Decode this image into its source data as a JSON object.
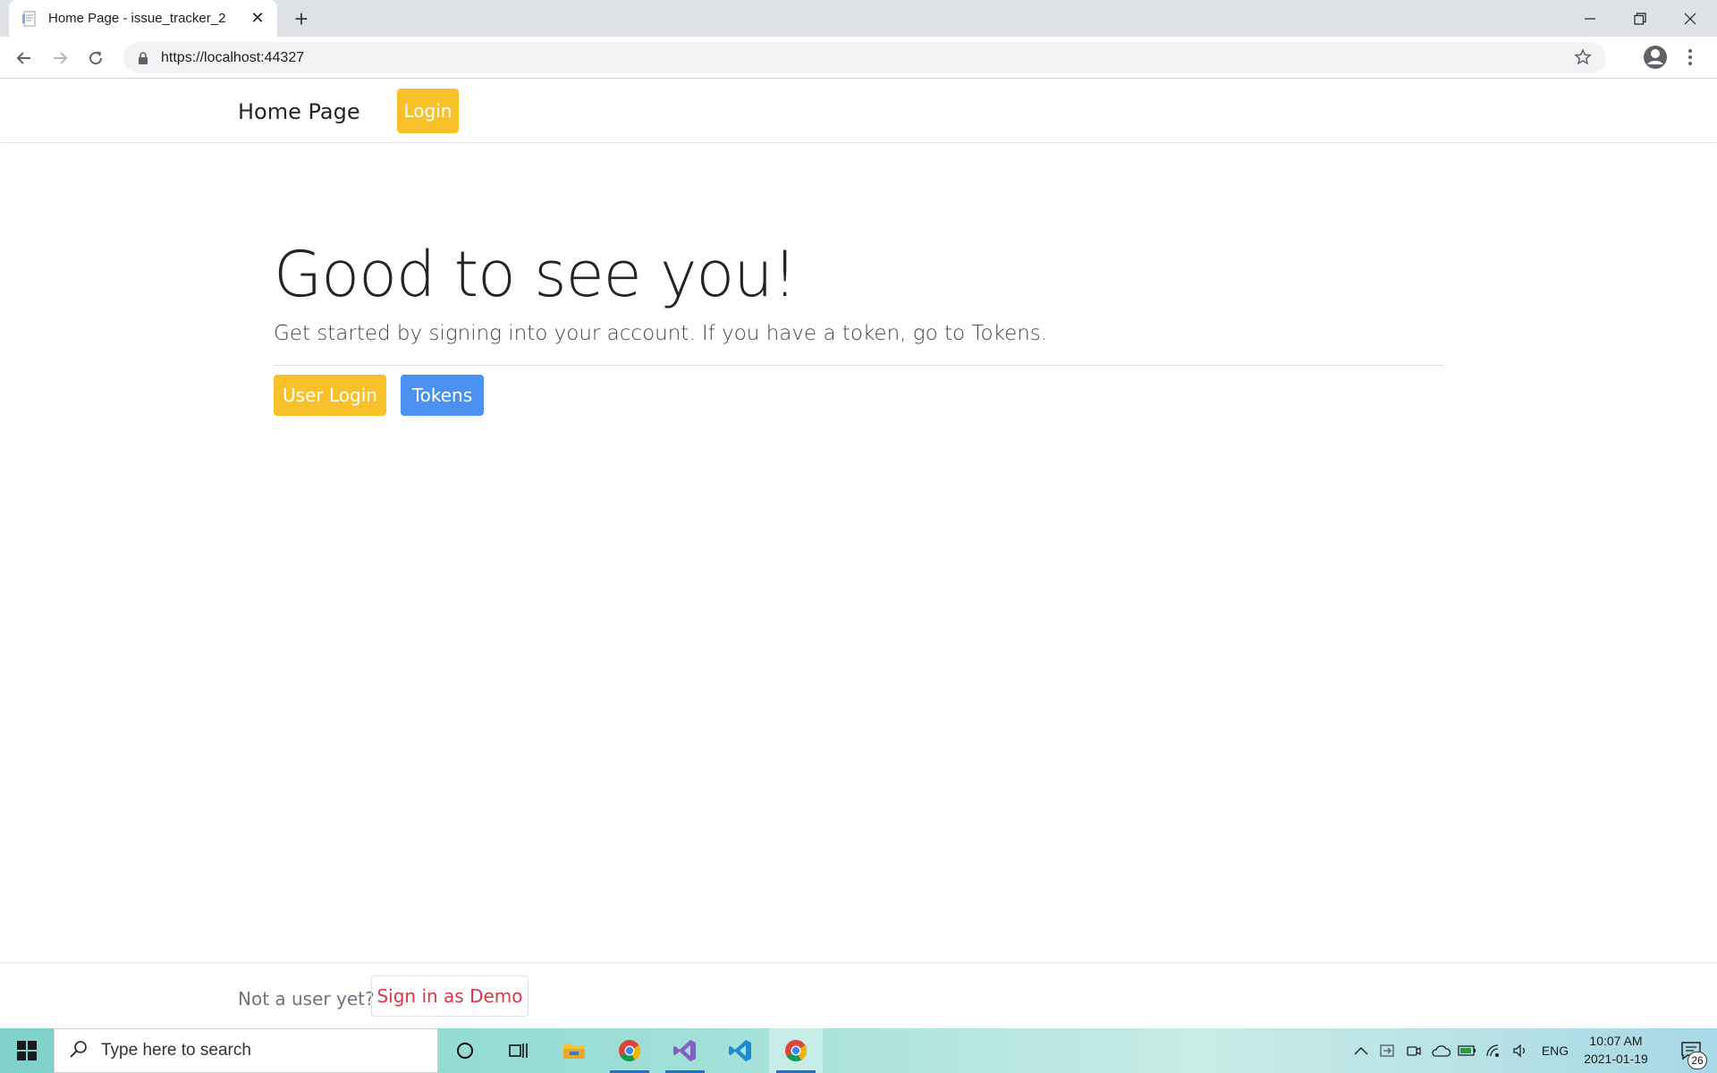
{
  "browser": {
    "tab_title": "Home Page - issue_tracker_2",
    "url": "https://localhost:44327"
  },
  "navbar": {
    "brand": "Home Page",
    "login_label": "Login"
  },
  "jumbotron": {
    "heading": "Good to see you!",
    "lead": "Get started by signing into your account. If you have a token, go to Tokens.",
    "user_login_label": "User Login",
    "tokens_label": "Tokens"
  },
  "footer": {
    "prompt": "Not a user yet?",
    "demo_label": "Sign in as Demo"
  },
  "taskbar": {
    "search_placeholder": "Type here to search",
    "language": "ENG",
    "time": "10:07 AM",
    "date": "2021-01-19",
    "notification_count": "26"
  },
  "colors": {
    "warning": "#f8c12a",
    "primary": "#4b91f1",
    "danger": "#dc3545"
  }
}
